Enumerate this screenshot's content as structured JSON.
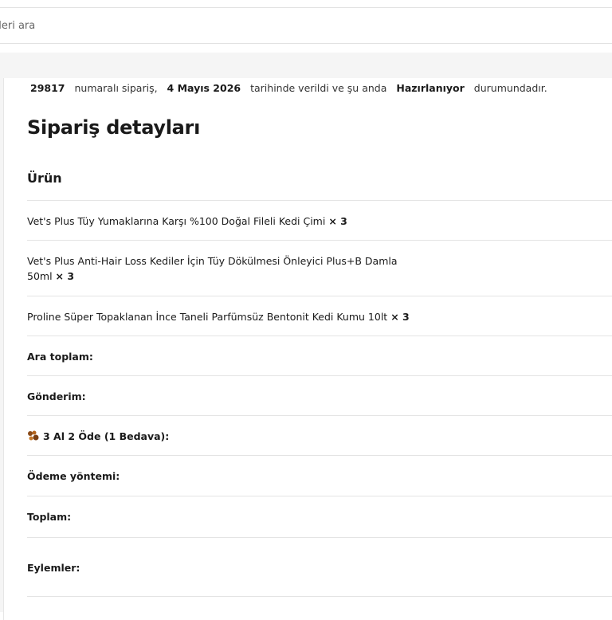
{
  "search": {
    "placeholder": "nleri ara"
  },
  "notice": {
    "order_number": "29817",
    "text1": "numaralı sipariş,",
    "date": "4 Mayıs 2026",
    "text2": "tarihinde verildi ve şu anda",
    "status": "Hazırlanıyor",
    "text3": "durumundadır."
  },
  "order": {
    "title": "Sipariş detayları",
    "column_product": "Ürün",
    "items": [
      {
        "name": "Vet's Plus Tüy Yumaklarına Karşı %100 Doğal Fileli Kedi Çimi",
        "qty": "× 3"
      },
      {
        "name": "Vet's Plus Anti-Hair Loss Kediler İçin Tüy Dökülmesi Önleyici Plus+B Damla 50ml",
        "qty": "× 3"
      },
      {
        "name": "Proline Süper Topaklanan İnce Taneli Parfümsüz Bentonit Kedi Kumu 10lt",
        "qty": "× 3"
      }
    ],
    "totals": {
      "subtotal_label": "Ara toplam:",
      "shipping_label": "Gönderim:",
      "promo_label": "3 Al 2 Öde (1 Bedava):",
      "payment_label": "Ödeme yöntemi:",
      "total_label": "Toplam:",
      "actions_label": "Eylemler:"
    }
  },
  "icons": {
    "promo": "paw-gift-icon"
  }
}
